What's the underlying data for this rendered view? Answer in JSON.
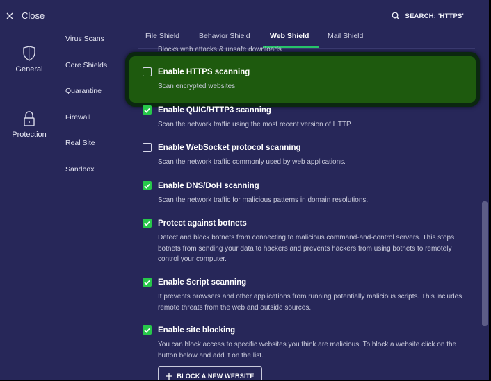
{
  "topbar": {
    "close_label": "Close",
    "search_label": "SEARCH: 'HTTPS'"
  },
  "rail": [
    {
      "label": "General",
      "icon": "shield-outline-icon"
    },
    {
      "label": "Protection",
      "icon": "lock-icon"
    }
  ],
  "submenu": [
    "Virus Scans",
    "Core Shields",
    "Quarantine",
    "Firewall",
    "Real Site",
    "Sandbox"
  ],
  "tabs": [
    {
      "label": "File Shield",
      "active": false
    },
    {
      "label": "Behavior Shield",
      "active": false
    },
    {
      "label": "Web Shield",
      "active": true
    },
    {
      "label": "Mail Shield",
      "active": false
    }
  ],
  "cutoff_text": "Blocks web attacks & unsafe downloads",
  "settings": [
    {
      "title": "Enable HTTPS scanning",
      "checked": false,
      "desc": "Scan encrypted websites."
    },
    {
      "title": "Enable QUIC/HTTP3 scanning",
      "checked": true,
      "desc": "Scan the network traffic using the most recent version of HTTP."
    },
    {
      "title": "Enable WebSocket protocol scanning",
      "checked": false,
      "desc": "Scan the network traffic commonly used by web applications."
    },
    {
      "title": "Enable DNS/DoH scanning",
      "checked": true,
      "desc": "Scan the network traffic for malicious patterns in domain resolutions."
    },
    {
      "title": "Protect against botnets",
      "checked": true,
      "desc": "Detect and block botnets from connecting to malicious command-and-control servers. This stops botnets from sending your data to hackers and prevents hackers from using botnets to remotely control your computer."
    },
    {
      "title": "Enable Script scanning",
      "checked": true,
      "desc": "It prevents browsers and other applications from running potentially malicious scripts. This includes remote threats from the web and outside sources."
    },
    {
      "title": "Enable site blocking",
      "checked": true,
      "desc": "You can block access to specific websites you think are malicious. To block a website click on the button below and add it on the list."
    }
  ],
  "block_button_label": "BLOCK A NEW WEBSITE",
  "colors": {
    "background": "#272759",
    "accent": "#27c84a",
    "highlight": "#1e5a0e"
  }
}
